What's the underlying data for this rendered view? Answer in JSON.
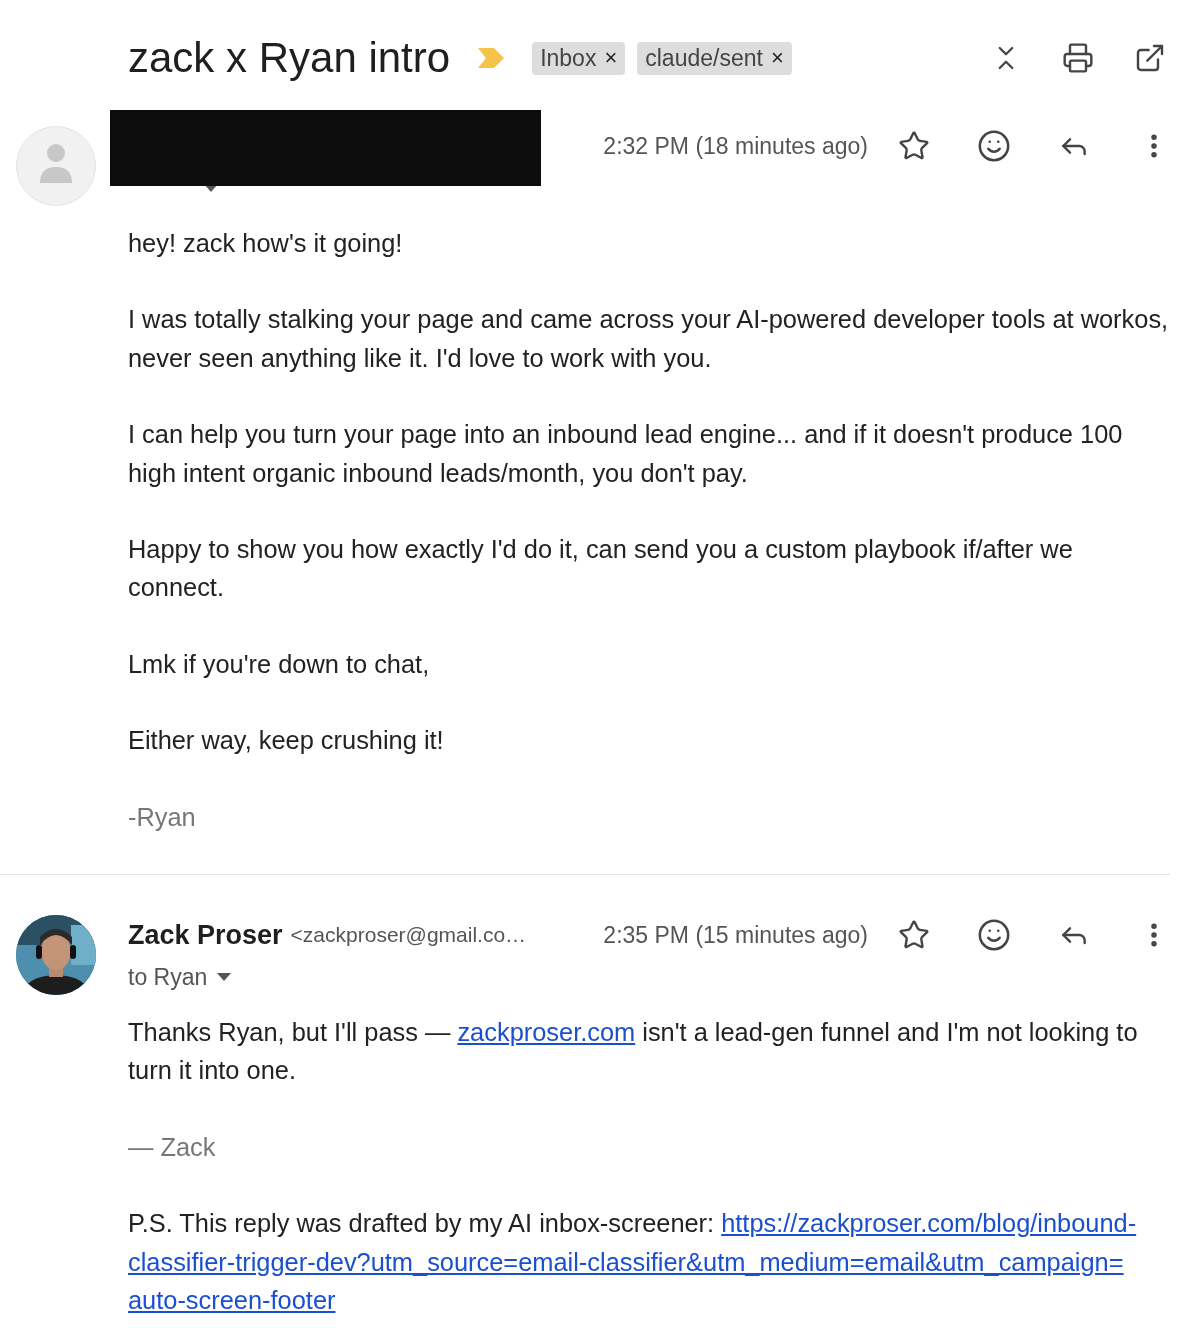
{
  "thread": {
    "title": "zack x Ryan intro",
    "important": true,
    "labels": [
      {
        "text": "Inbox",
        "remove": "×"
      },
      {
        "text": "claude/sent",
        "remove": "×"
      }
    ]
  },
  "messages": [
    {
      "avatar": {
        "kind": "placeholder"
      },
      "redacted": true,
      "time": "2:32 PM (18 minutes ago)",
      "starred": false,
      "paragraphs": [
        {
          "kind": "text",
          "parts": [
            {
              "kind": "text",
              "text": "hey! zack how's it going!"
            }
          ]
        },
        {
          "kind": "text",
          "parts": [
            {
              "kind": "text",
              "text": "I was totally stalking your page and came across your AI-powered developer tools at workos, never seen anything like it. I'd love to work with you."
            }
          ]
        },
        {
          "kind": "text",
          "parts": [
            {
              "kind": "text",
              "text": "I can help you turn your page into an inbound lead engine... and if it doesn't produce 100 high intent organic inbound leads/month, you don't pay."
            }
          ]
        },
        {
          "kind": "text",
          "parts": [
            {
              "kind": "text",
              "text": "Happy to show you how exactly I'd do it, can send you a custom playbook if/after we connect."
            }
          ]
        },
        {
          "kind": "text",
          "parts": [
            {
              "kind": "text",
              "text": "Lmk if you're down to chat,"
            }
          ]
        },
        {
          "kind": "text",
          "parts": [
            {
              "kind": "text",
              "text": "Either way, keep crushing it!"
            }
          ]
        },
        {
          "kind": "signature",
          "parts": [
            {
              "kind": "text",
              "text": "-Ryan"
            }
          ]
        }
      ]
    },
    {
      "avatar": {
        "kind": "picture"
      },
      "sender_name": "Zack Proser",
      "sender_email": "<zackproser@gmail.co…",
      "time": "2:35 PM (15 minutes ago)",
      "starred": false,
      "recipient": "to Ryan",
      "paragraphs": [
        {
          "kind": "text",
          "parts": [
            {
              "kind": "text",
              "text": "Thanks Ryan, but I'll pass — "
            },
            {
              "kind": "link",
              "text": "zackproser.com"
            },
            {
              "kind": "text",
              "text": " isn't a lead-gen funnel and I'm not looking to turn it into one."
            }
          ]
        },
        {
          "kind": "signature",
          "parts": [
            {
              "kind": "text",
              "text": "— Zack"
            }
          ]
        },
        {
          "kind": "text",
          "parts": [
            {
              "kind": "text",
              "text": "P.S. This reply was drafted by my AI inbox-screener: "
            },
            {
              "kind": "link",
              "text": "https://zackproser.com/blog/inbound-"
            },
            {
              "kind": "link",
              "text": "classifier-trigger-dev?utm_source=email-classifier&utm_medium=email&utm_campaign="
            },
            {
              "kind": "link",
              "text": "auto-screen-footer"
            }
          ]
        }
      ]
    }
  ]
}
